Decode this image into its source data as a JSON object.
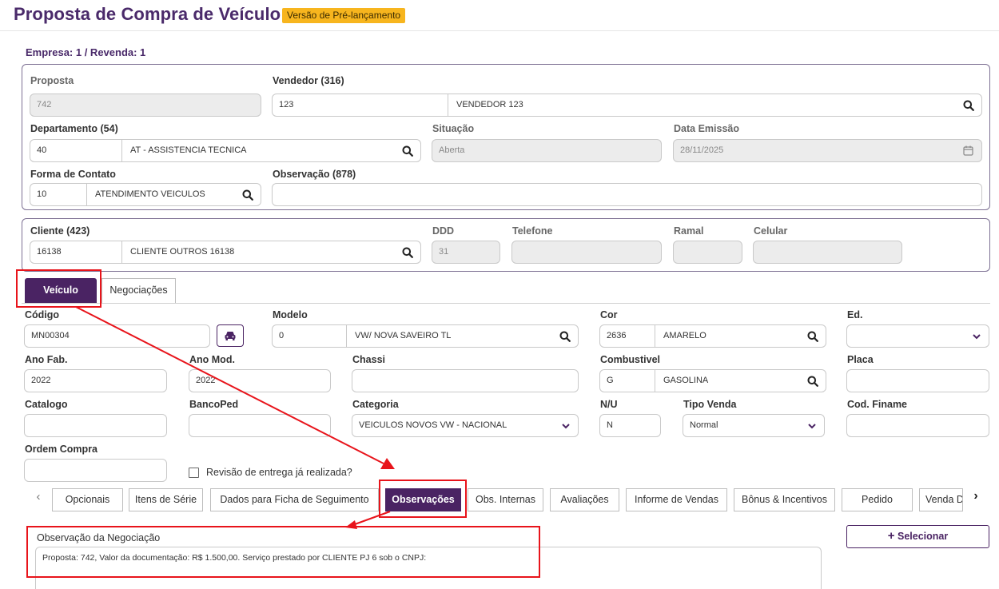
{
  "header": {
    "title": "Proposta de Compra de Veículo",
    "badge": "Versão de Pré-lançamento",
    "empresa": "Empresa: 1 / Revenda: 1"
  },
  "proposal": {
    "proposta_label": "Proposta",
    "proposta_value": "742",
    "vendedor_label": "Vendedor (316)",
    "vendedor_code": "123",
    "vendedor_name": "VENDEDOR 123",
    "departamento_label": "Departamento (54)",
    "departamento_code": "40",
    "departamento_name": "AT - ASSISTENCIA TECNICA",
    "situacao_label": "Situação",
    "situacao_value": "Aberta",
    "data_emissao_label": "Data Emissão",
    "data_emissao_value": "28/11/2025",
    "forma_contato_label": "Forma de Contato",
    "forma_contato_code": "10",
    "forma_contato_name": "ATENDIMENTO VEICULOS",
    "observacao_label": "Observação (878)",
    "observacao_value": ""
  },
  "client": {
    "cliente_label": "Cliente (423)",
    "cliente_code": "16138",
    "cliente_name": "CLIENTE OUTROS 16138",
    "ddd_label": "DDD",
    "ddd_value": "31",
    "telefone_label": "Telefone",
    "ramal_label": "Ramal",
    "celular_label": "Celular"
  },
  "tabs": [
    "Veículo",
    "Negociações"
  ],
  "vehicle": {
    "codigo_label": "Código",
    "codigo_value": "MN00304",
    "modelo_label": "Modelo",
    "modelo_code": "0",
    "modelo_name": "VW/ NOVA SAVEIRO TL",
    "cor_label": "Cor",
    "cor_code": "2636",
    "cor_name": "AMARELO",
    "ed_label": "Ed.",
    "ano_fab_label": "Ano Fab.",
    "ano_fab_value": "2022",
    "ano_mod_label": "Ano Mod.",
    "ano_mod_value": "2022",
    "chassi_label": "Chassi",
    "combustivel_label": "Combustivel",
    "combustivel_code": "G",
    "combustivel_name": "GASOLINA",
    "placa_label": "Placa",
    "catalogo_label": "Catalogo",
    "bancoped_label": "BancoPed",
    "categoria_label": "Categoria",
    "categoria_value": "VEICULOS NOVOS VW - NACIONAL",
    "nu_label": "N/U",
    "nu_value": "N",
    "tipo_venda_label": "Tipo Venda",
    "tipo_venda_value": "Normal",
    "cod_finame_label": "Cod. Finame",
    "ordem_compra_label": "Ordem Compra",
    "revisao_label": "Revisão de entrega já realizada?"
  },
  "subtabs": [
    "Opcionais",
    "Itens de Série",
    "Dados para Ficha de Seguimento",
    "Observações",
    "Obs. Internas",
    "Avaliações",
    "Informe de Vendas",
    "Bônus & Incentivos",
    "Pedido",
    "Venda D"
  ],
  "observacoes": {
    "label": "Observação da Negociação",
    "text": "Proposta: 742, Valor da documentação: R$ 1.500,00. Serviço prestado por CLIENTE PJ 6 sob o CNPJ:",
    "selecionar_label": "Selecionar"
  },
  "colors": {
    "primary": "#4a2363",
    "badge": "#f7b51e",
    "annotation": "#e8141b"
  }
}
